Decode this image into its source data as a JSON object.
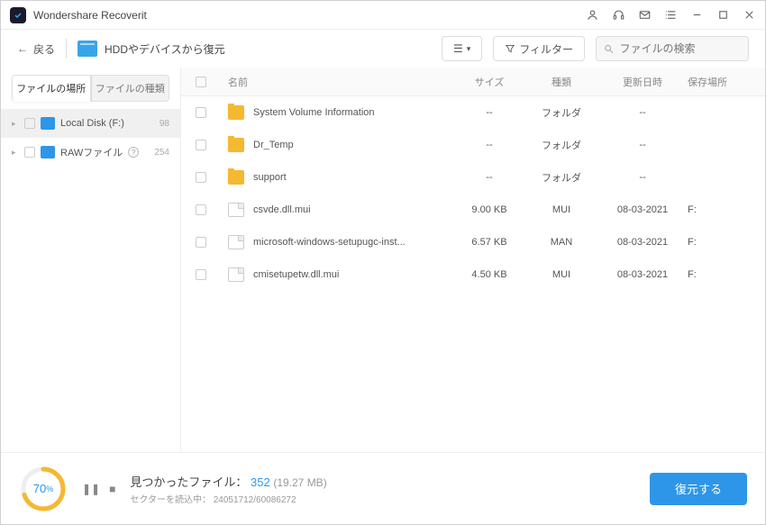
{
  "app_title": "Wondershare Recoverit",
  "toolbar": {
    "back_label": "戻る",
    "location_label": "HDDやデバイスから復元",
    "filter_label": "フィルター",
    "search_placeholder": "ファイルの検索"
  },
  "sidebar": {
    "tabs": {
      "location": "ファイルの場所",
      "type": "ファイルの種類"
    },
    "items": [
      {
        "label": "Local Disk (F:)",
        "count": "98",
        "icon": "disk",
        "expandable": true,
        "selected": true
      },
      {
        "label": "RAWファイル",
        "count": "254",
        "icon": "disk",
        "help": true,
        "expandable": true
      }
    ]
  },
  "columns": {
    "name": "名前",
    "size": "サイズ",
    "type": "種類",
    "date": "更新日時",
    "path": "保存場所"
  },
  "rows": [
    {
      "name": "System Volume Information",
      "size": "--",
      "type": "フォルダ",
      "date": "--",
      "path": "",
      "icon": "folder"
    },
    {
      "name": "Dr_Temp",
      "size": "--",
      "type": "フォルダ",
      "date": "--",
      "path": "",
      "icon": "folder"
    },
    {
      "name": "support",
      "size": "--",
      "type": "フォルダ",
      "date": "--",
      "path": "",
      "icon": "folder"
    },
    {
      "name": "csvde.dll.mui",
      "size": "9.00 KB",
      "type": "MUI",
      "date": "08-03-2021",
      "path": "F:",
      "icon": "file"
    },
    {
      "name": "microsoft-windows-setupugc-inst...",
      "size": "6.57 KB",
      "type": "MAN",
      "date": "08-03-2021",
      "path": "F:",
      "icon": "file"
    },
    {
      "name": "cmisetupetw.dll.mui",
      "size": "4.50 KB",
      "type": "MUI",
      "date": "08-03-2021",
      "path": "F:",
      "icon": "file"
    }
  ],
  "footer": {
    "progress_pct": "70",
    "found_label": "見つかったファイル：",
    "found_count": "352",
    "found_size": "(19.27 MB)",
    "sector_label": "セクターを読込中：",
    "sector_value": "24051712/60086272",
    "recover_label": "復元する"
  }
}
